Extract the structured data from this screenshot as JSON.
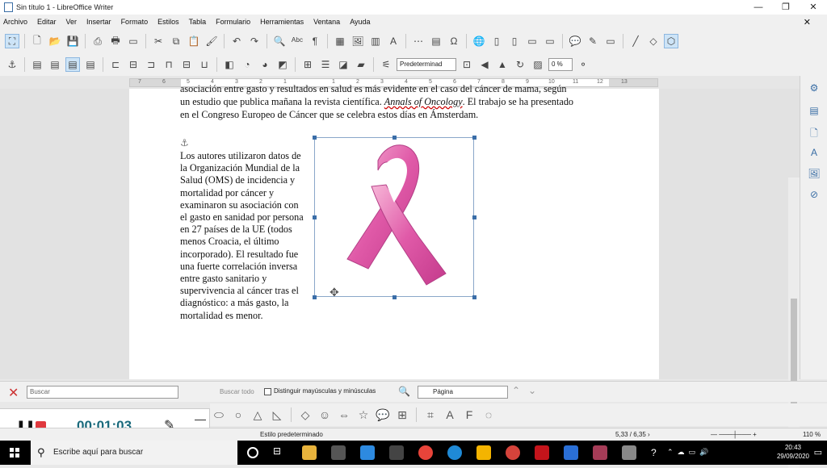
{
  "window": {
    "title": "Sin título 1 - LibreOffice Writer",
    "controls": [
      "—",
      "❐",
      "✕"
    ]
  },
  "menu": [
    "Archivo",
    "Editar",
    "Ver",
    "Insertar",
    "Formato",
    "Estilos",
    "Tabla",
    "Formulario",
    "Herramientas",
    "Ventana",
    "Ayuda"
  ],
  "toolbar": {
    "style_value": "Predeterminad",
    "transparency_value": "0 %"
  },
  "ruler": {
    "marks": [
      "7",
      "6",
      "5",
      "4",
      "3",
      "2",
      "1",
      "",
      "1",
      "2",
      "3",
      "4",
      "5",
      "6",
      "7",
      "8",
      "9",
      "10",
      "11",
      "12",
      "13"
    ]
  },
  "document": {
    "para1_line1": "asociación entre gasto y resultados en salud es más evidente en el caso del cáncer de mama, según",
    "para1_line2_a": "un estudio que publica mañana la revista científica. ",
    "para1_line2_journal": "Annals of Oncology",
    "para1_line2_b": ". El trabajo se ha presentado",
    "para1_line3": "en el Congreso Europeo de Cáncer que se celebra estos días en Ámsterdam.",
    "para2_lines": [
      "Los autores utilizaron datos de",
      "la Organización Mundial de la",
      "Salud (OMS) de incidencia y",
      "mortalidad por cáncer y",
      "examinaron su asociación con",
      "el gasto en sanidad por persona",
      "en 27 países de la UE (todos",
      "menos Croacia, el último",
      "incorporado). El resultado fue",
      "una fuerte correlación inversa",
      "entre gasto sanitario y",
      "supervivencia al cáncer tras el",
      "diagnóstico: a más gasto, la",
      "mortalidad es menor."
    ]
  },
  "findbar": {
    "placeholder": "Buscar",
    "find_all": "Buscar todo",
    "match_case": "Distinguir mayúsculas y minúsculas",
    "search_scope": "Página"
  },
  "recorder": {
    "time": "00:01:03"
  },
  "statusbar": {
    "page_style": "Estilo predeterminado",
    "position": "5,33 / 6,35 ›",
    "zoom": "110 %"
  },
  "taskbar": {
    "search_placeholder": "Escribe aquí para buscar",
    "time": "20:43",
    "date": "29/09/2020"
  }
}
